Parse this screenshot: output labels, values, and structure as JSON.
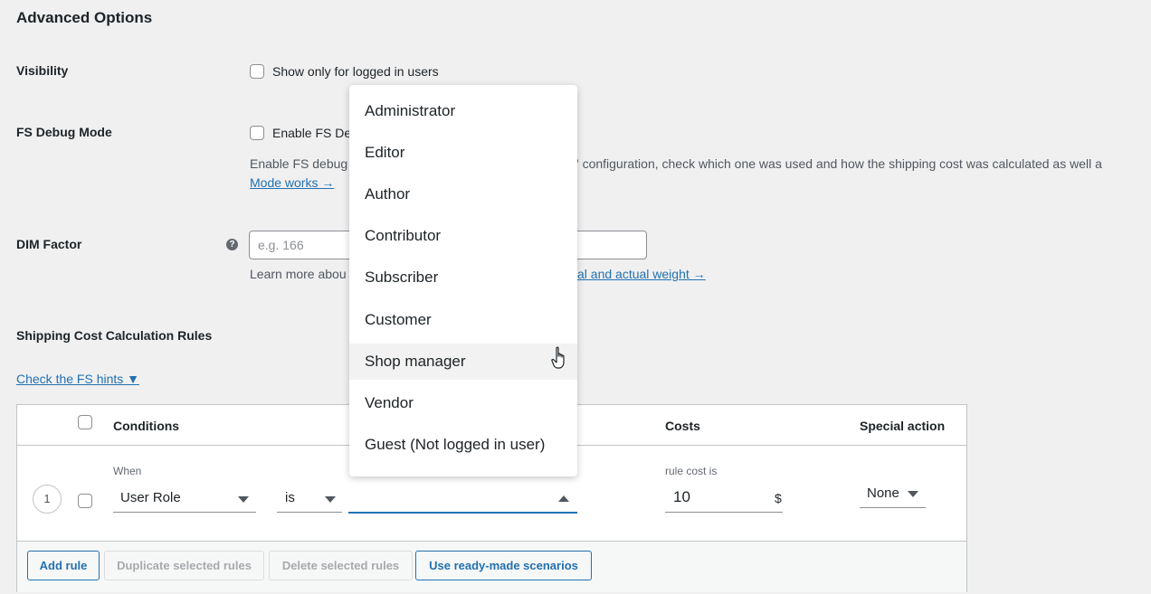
{
  "section_title": "Advanced Options",
  "visibility": {
    "label": "Visibility",
    "checkbox_label": "Show only for logged in users"
  },
  "debug": {
    "label": "FS Debug Mode",
    "checkbox_label": "Enable FS De",
    "desc_part1": "Enable FS debug",
    "desc_part2": "s' configuration, check which one was used and how the shipping cost was calculated as well a",
    "link": "Mode works →"
  },
  "dim": {
    "label": "DIM Factor",
    "help_icon": "question-icon",
    "placeholder": "e.g. 166",
    "learn_prefix": "Learn more abou",
    "learn_link": "al and actual weight →"
  },
  "rules": {
    "title": "Shipping Cost Calculation Rules",
    "hints_link": "Check the FS hints ▼",
    "headers": {
      "conditions": "Conditions",
      "costs": "Costs",
      "special": "Special action"
    },
    "row": {
      "number": "1",
      "when_label": "When",
      "condition_value": "User Role",
      "operator_value": "is",
      "cost_label": "rule cost is",
      "cost_value": "10",
      "currency": "$",
      "special_value": "None"
    },
    "buttons": {
      "add": "Add rule",
      "duplicate": "Duplicate selected rules",
      "delete": "Delete selected rules",
      "scenarios": "Use ready-made scenarios"
    }
  },
  "dropdown": {
    "options": [
      "Administrator",
      "Editor",
      "Author",
      "Contributor",
      "Subscriber",
      "Customer",
      "Shop manager",
      "Vendor",
      "Guest (Not logged in user)"
    ],
    "hovered": "Shop manager"
  },
  "colors": {
    "link": "#2271b1",
    "background": "#f0f0f1"
  }
}
